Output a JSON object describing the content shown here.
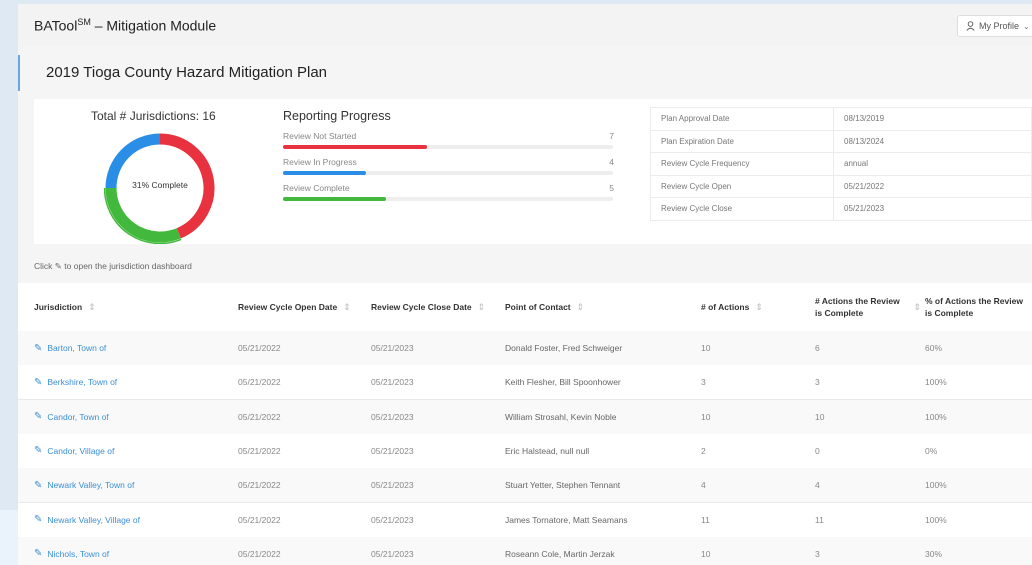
{
  "header": {
    "app_name": "BATool",
    "app_sup": "SM",
    "module": " – Mitigation Module",
    "profile_label": "My Profile"
  },
  "plan": {
    "title": "2019 Tioga County Hazard Mitigation Plan"
  },
  "summary": {
    "total_label": "Total # Jurisdictions: 16",
    "complete_label": "31% Complete",
    "complete_fraction": 0.31
  },
  "reporting_progress": {
    "title": "Reporting Progress",
    "total": 16,
    "items": [
      {
        "label": "Review Not Started",
        "count": 7,
        "color": "#e8323f"
      },
      {
        "label": "Review In Progress",
        "count": 4,
        "color": "#2b8ee6"
      },
      {
        "label": "Review Complete",
        "count": 5,
        "color": "#42b93c"
      }
    ]
  },
  "plan_info": [
    {
      "key": "Plan Approval Date",
      "value": "08/13/2019"
    },
    {
      "key": "Plan Expiration Date",
      "value": "08/13/2024"
    },
    {
      "key": "Review Cycle Frequency",
      "value": "annual"
    },
    {
      "key": "Review Cycle Open",
      "value": "05/21/2022"
    },
    {
      "key": "Review Cycle Close",
      "value": "05/21/2023"
    }
  ],
  "hint": {
    "before": "Click",
    "after": "to open the jurisdiction dashboard"
  },
  "table": {
    "columns": [
      "Jurisdiction",
      "Review Cycle Open Date",
      "Review Cycle Close Date",
      "Point of Contact",
      "# of Actions",
      "# Actions the Review is Complete",
      "% of Actions the Review is Complete"
    ],
    "rows": [
      [
        "Barton, Town of",
        "05/21/2022",
        "05/21/2023",
        "Donald Foster, Fred Schweiger",
        "10",
        "6",
        "60%"
      ],
      [
        "Berkshire, Town of",
        "05/21/2022",
        "05/21/2023",
        "Keith Flesher, Bill Spoonhower",
        "3",
        "3",
        "100%"
      ],
      [
        "Candor, Town of",
        "05/21/2022",
        "05/21/2023",
        "William Strosahl, Kevin Noble",
        "10",
        "10",
        "100%"
      ],
      [
        "Candor, Village of",
        "05/21/2022",
        "05/21/2023",
        "Eric Halstead, null null",
        "2",
        "0",
        "0%"
      ],
      [
        "Newark Valley, Town of",
        "05/21/2022",
        "05/21/2023",
        "Stuart Yetter, Stephen Tennant",
        "4",
        "4",
        "100%"
      ],
      [
        "Newark Valley, Village of",
        "05/21/2022",
        "05/21/2023",
        "James Tornatore, Matt Seamans",
        "11",
        "11",
        "100%"
      ],
      [
        "Nichols, Town of",
        "05/21/2022",
        "05/21/2023",
        "Roseann Cole, Martin Jerzak",
        "10",
        "3",
        "30%"
      ]
    ]
  }
}
